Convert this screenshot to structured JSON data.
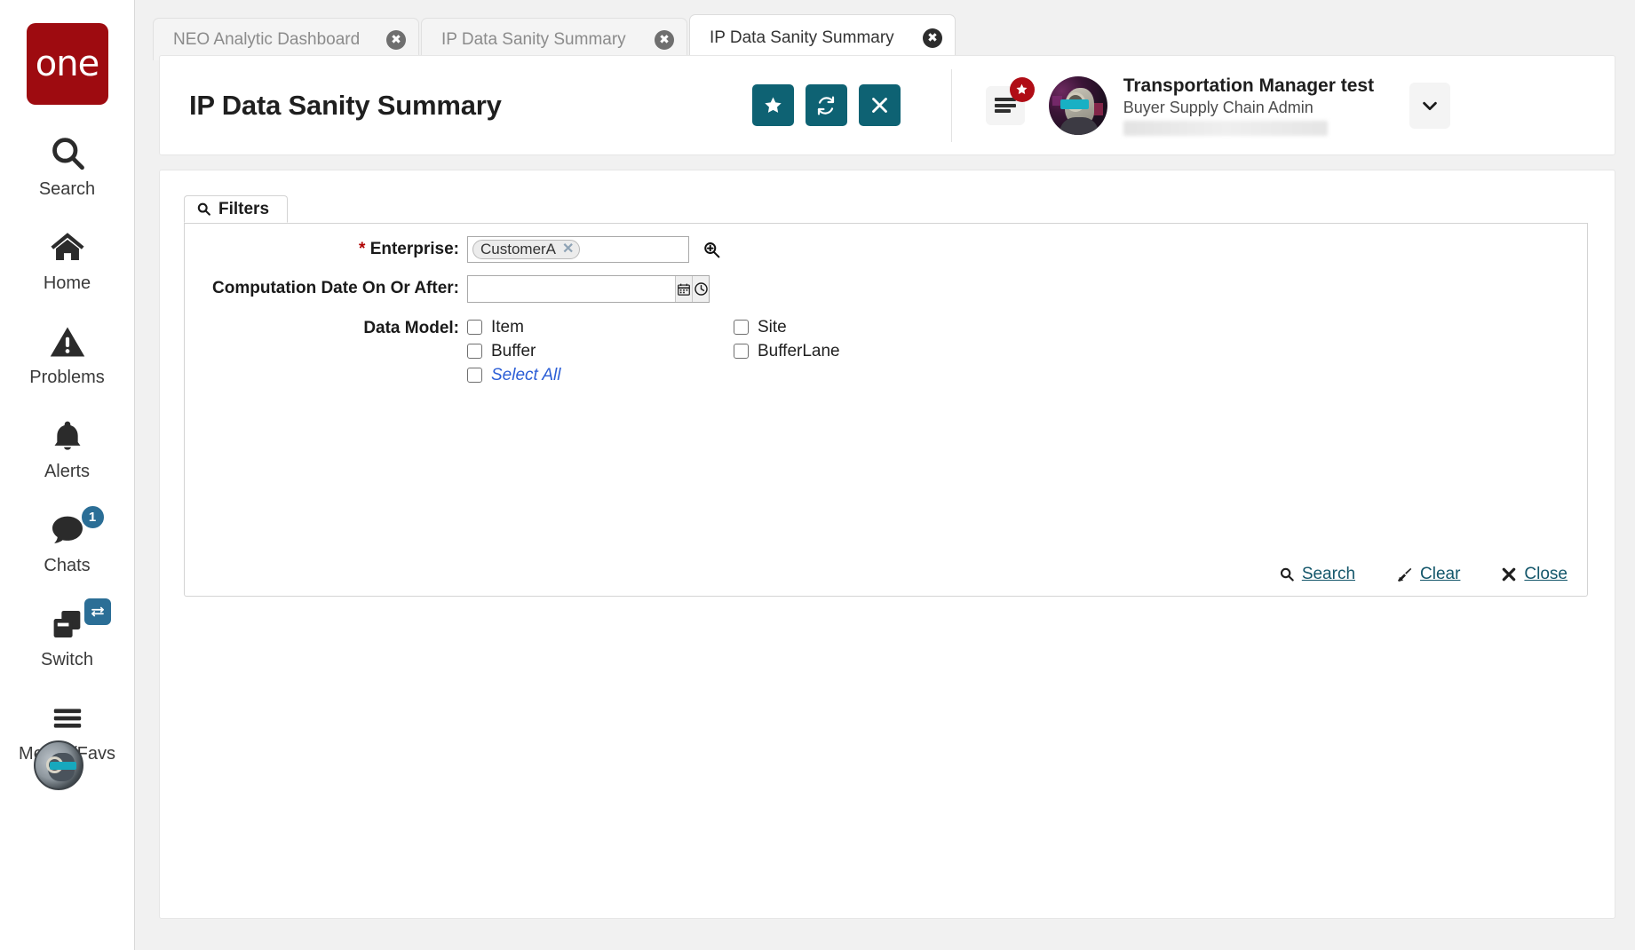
{
  "brand": {
    "logo_text": "one"
  },
  "sidebar": {
    "items": [
      {
        "label": "Search",
        "icon": "search-icon",
        "badge": null
      },
      {
        "label": "Home",
        "icon": "home-icon",
        "badge": null
      },
      {
        "label": "Problems",
        "icon": "warning-triangle-icon",
        "badge": null
      },
      {
        "label": "Alerts",
        "icon": "bell-icon",
        "badge": null
      },
      {
        "label": "Chats",
        "icon": "chat-bubble-icon",
        "badge": "1"
      },
      {
        "label": "Switch",
        "icon": "switch-windows-icon",
        "badge": "swap-arrows-icon"
      },
      {
        "label": "Menus/Favs",
        "icon": "hamburger-icon",
        "badge": null
      }
    ],
    "avatar_name": "sidebar-user-avatar"
  },
  "tabs": [
    {
      "label": "NEO Analytic Dashboard",
      "active": false,
      "close_icon": "close-circle-icon"
    },
    {
      "label": "IP Data Sanity Summary",
      "active": false,
      "close_icon": "close-circle-icon"
    },
    {
      "label": "IP Data Sanity Summary",
      "active": true,
      "close_icon": "close-circle-icon"
    }
  ],
  "header": {
    "title": "IP Data Sanity Summary",
    "actions": [
      {
        "name": "favorite-button",
        "icon": "star-icon"
      },
      {
        "name": "refresh-button",
        "icon": "refresh-icon"
      },
      {
        "name": "close-button",
        "icon": "x-icon"
      }
    ],
    "menu_icon": "hamburger-menu-icon",
    "menu_badge_icon": "star-badge-icon",
    "user": {
      "name": "Transportation Manager test",
      "role": "Buyer Supply Chain Admin",
      "redacted": true
    },
    "caret_icon": "chevron-down-icon",
    "accent_color": "#0e6273",
    "badge_color": "#b00d16"
  },
  "filters": {
    "tab_label": "Filters",
    "tab_icon": "search-icon",
    "rows": {
      "enterprise": {
        "label": "Enterprise:",
        "required_marker": "*",
        "token": "CustomerA",
        "token_remove_icon": "x-icon",
        "lookup_icon": "zoom-search-icon"
      },
      "computation_date": {
        "label": "Computation Date On Or After:",
        "value": "",
        "placeholder": "",
        "calendar_icon": "calendar-icon",
        "clock_icon": "clock-icon"
      },
      "data_model": {
        "label": "Data Model:",
        "left_column": [
          {
            "label": "Item",
            "checked": false
          },
          {
            "label": "Buffer",
            "checked": false
          },
          {
            "label": "Select All",
            "checked": false,
            "style": "link"
          }
        ],
        "right_column": [
          {
            "label": "Site",
            "checked": false
          },
          {
            "label": "BufferLane",
            "checked": false
          }
        ]
      }
    },
    "actions": [
      {
        "label": "Search",
        "icon": "search-icon",
        "name": "search-link"
      },
      {
        "label": "Clear",
        "icon": "broom-icon",
        "name": "clear-link"
      },
      {
        "label": "Close",
        "icon": "x-bold-icon",
        "name": "close-link"
      }
    ],
    "link_color": "#13566a"
  }
}
